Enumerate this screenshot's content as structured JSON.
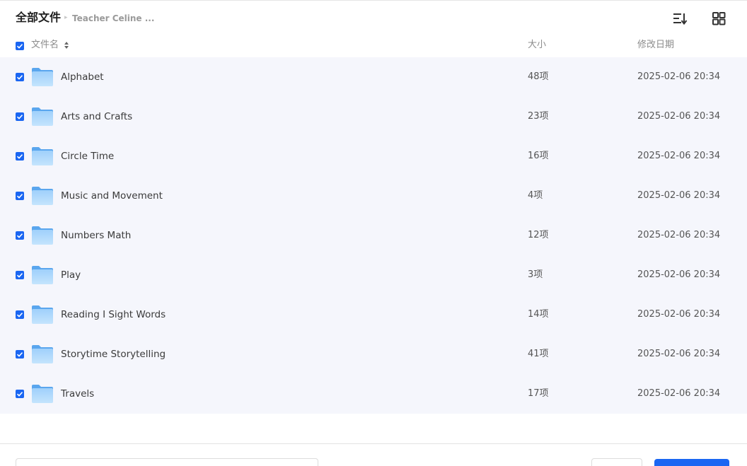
{
  "breadcrumb": {
    "root": "全部文件",
    "separator": "▸",
    "current": "Teacher Celine ..."
  },
  "toolbar": {
    "sort_icon": "sort-list-icon",
    "view_icon": "grid-view-icon"
  },
  "columns": {
    "name": "文件名",
    "size": "大小",
    "modified": "修改日期"
  },
  "files": [
    {
      "name": "Alphabet",
      "size": "48项",
      "modified": "2025-02-06 20:34"
    },
    {
      "name": "Arts and Crafts",
      "size": "23项",
      "modified": "2025-02-06 20:34"
    },
    {
      "name": "Circle Time",
      "size": "16项",
      "modified": "2025-02-06 20:34"
    },
    {
      "name": "Music and Movement",
      "size": "4项",
      "modified": "2025-02-06 20:34"
    },
    {
      "name": "Numbers Math",
      "size": "12项",
      "modified": "2025-02-06 20:34"
    },
    {
      "name": "Play",
      "size": "3项",
      "modified": "2025-02-06 20:34"
    },
    {
      "name": "Reading I Sight Words",
      "size": "14项",
      "modified": "2025-02-06 20:34"
    },
    {
      "name": "Storytime Storytelling",
      "size": "41项",
      "modified": "2025-02-06 20:34"
    },
    {
      "name": "Travels",
      "size": "17项",
      "modified": "2025-02-06 20:34"
    }
  ],
  "colors": {
    "accent": "#1a66f2",
    "selected_row_bg": "#f5f6fc",
    "folder": "#8ec3f5"
  }
}
